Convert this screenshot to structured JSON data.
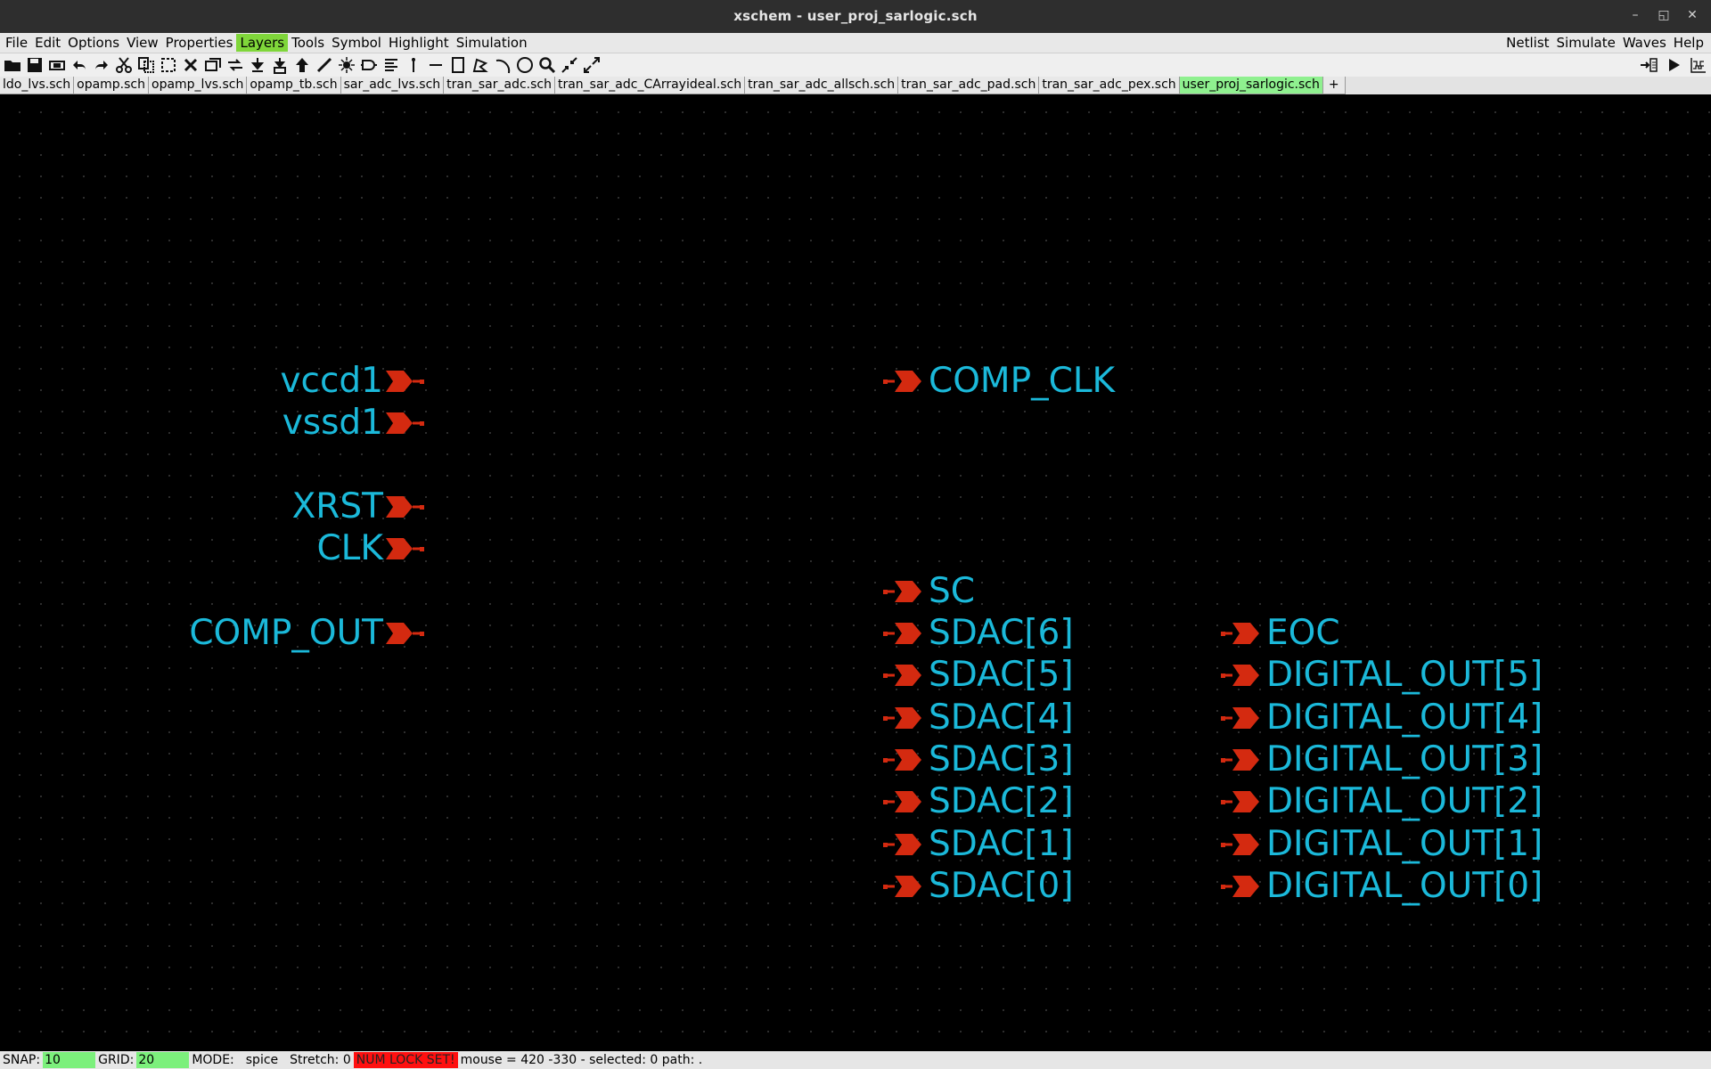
{
  "window": {
    "title": "xschem - user_proj_sarlogic.sch"
  },
  "menu": {
    "left": [
      "File",
      "Edit",
      "Options",
      "View",
      "Properties",
      "Layers",
      "Tools",
      "Symbol",
      "Highlight",
      "Simulation"
    ],
    "right": [
      "Netlist",
      "Simulate",
      "Waves",
      "Help"
    ],
    "active": "Layers"
  },
  "tabs": [
    "ldo_lvs.sch",
    "opamp.sch",
    "opamp_lvs.sch",
    "opamp_tb.sch",
    "sar_adc_lvs.sch",
    "tran_sar_adc.sch",
    "tran_sar_adc_CArrayideal.sch",
    "tran_sar_adc_allsch.sch",
    "tran_sar_adc_pad.sch",
    "tran_sar_adc_pex.sch",
    "user_proj_sarlogic.sch"
  ],
  "active_tab": "user_proj_sarlogic.sch",
  "add_tab": "+",
  "schematic": {
    "input_pins": [
      "vccd1",
      "vssd1",
      "XRST",
      "CLK",
      "COMP_OUT"
    ],
    "output_pins_col1": [
      "COMP_CLK",
      "SC",
      "SDAC[6]",
      "SDAC[5]",
      "SDAC[4]",
      "SDAC[3]",
      "SDAC[2]",
      "SDAC[1]",
      "SDAC[0]"
    ],
    "output_pins_col2": [
      "EOC",
      "DIGITAL_OUT[5]",
      "DIGITAL_OUT[4]",
      "DIGITAL_OUT[3]",
      "DIGITAL_OUT[2]",
      "DIGITAL_OUT[1]",
      "DIGITAL_OUT[0]"
    ]
  },
  "status": {
    "snap_label": "SNAP:",
    "snap_value": "10",
    "grid_label": "GRID:",
    "grid_value": "20",
    "mode_label": "MODE:",
    "mode_value": "spice",
    "stretch": "Stretch: 0",
    "numlock": "NUM LOCK SET!",
    "mouse": "mouse = 420 -330 - selected: 0 path: ."
  },
  "colors": {
    "pin_text": "#1bb9da",
    "pin_symbol": "#d42a10",
    "active_tab": "#8ff08f",
    "active_menu": "#7fd63a"
  }
}
